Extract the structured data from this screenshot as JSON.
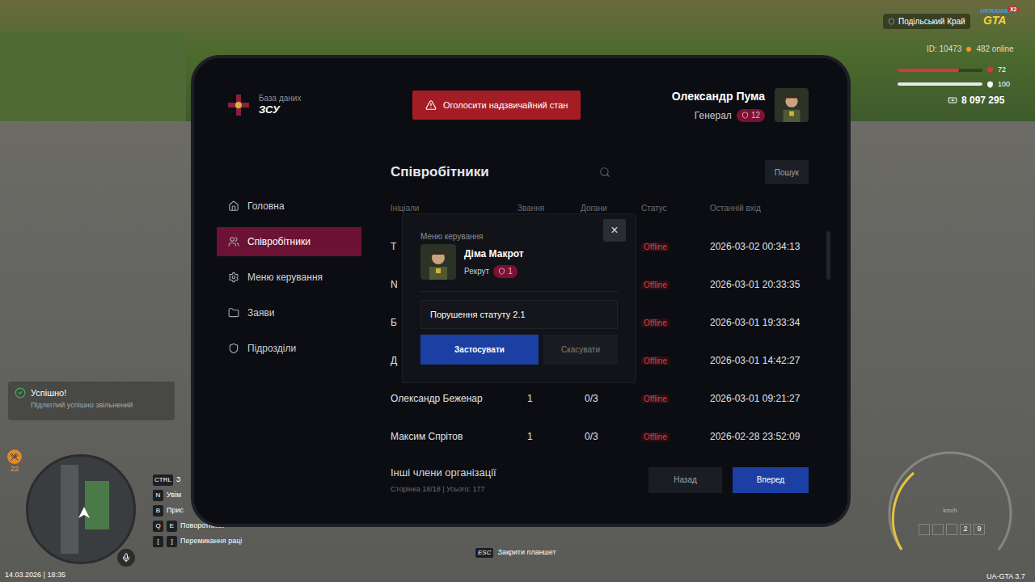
{
  "hud": {
    "region": "Подільський Край",
    "logo": {
      "top": "UKRAINE",
      "bottom": "GTA",
      "badge": "X2"
    },
    "id": "ID: 10473",
    "online": "482 online",
    "health": {
      "reading": "72",
      "level": 0.72
    },
    "armor": {
      "reading": "100",
      "level": 1
    },
    "money": "8 097 295",
    "hunger": "22",
    "datetime": "14.03.2026 | 18:35",
    "close_hint": {
      "key": "ESC",
      "label": "Закрити планшет"
    },
    "speedometer": {
      "unit": "km/h",
      "gears": [
        "2",
        "9"
      ]
    },
    "version": "UA-GTA 3.7"
  },
  "keybinds": [
    {
      "keys": [
        "CTRL"
      ],
      "label": "З"
    },
    {
      "keys": [
        "N"
      ],
      "label": "Увім"
    },
    {
      "keys": [
        "B"
      ],
      "label": "Прис"
    },
    {
      "keys": [
        "Q",
        "E"
      ],
      "label": "Поворотники"
    },
    {
      "keys": [
        "[",
        "]"
      ],
      "label": "Перемикання раці"
    }
  ],
  "toast": {
    "title": "Успішно!",
    "message": "Підлеглий успішно звільнений"
  },
  "tablet": {
    "brand": {
      "subtitle": "База даних",
      "title": "ЗСУ"
    },
    "emergency_button": "Оголосити надзвичайний стан",
    "user": {
      "name": "Олександр Пума",
      "rank": "Генерал",
      "level": "12"
    },
    "sidebar": [
      {
        "label": "Головна",
        "selected": false
      },
      {
        "label": "Співробітники",
        "selected": true
      },
      {
        "label": "Меню керування",
        "selected": false
      },
      {
        "label": "Заяви",
        "selected": false
      },
      {
        "label": "Підрозділи",
        "selected": false
      }
    ],
    "page": {
      "title": "Співробітники",
      "search_button": "Пошук",
      "table": {
        "columns": [
          "Ініціали",
          "Звання",
          "Догани",
          "Статус",
          "Останній вхід"
        ],
        "rows": [
          {
            "name": "Т",
            "status": "Offline",
            "last_login": "2026-03-02 00:34:13"
          },
          {
            "name": "N",
            "status": "Offline",
            "last_login": "2026-03-01 20:33:35"
          },
          {
            "name": "Б",
            "status": "Offline",
            "last_login": "2026-03-01 19:33:34"
          },
          {
            "name": "Д",
            "status": "Offline",
            "last_login": "2026-03-01 14:42:27"
          },
          {
            "name": "Олександр Беженар",
            "rank": "1",
            "warnings": "0/3",
            "status": "Offline",
            "last_login": "2026-03-01 09:21:27"
          },
          {
            "name": "Максим Спрітов",
            "rank": "1",
            "warnings": "0/3",
            "status": "Offline",
            "last_login": "2026-02-28 23:52:09"
          }
        ]
      },
      "footer": {
        "title": "Інші члени організації",
        "info": "Сторінка 18/18 | Усього: 177",
        "prev": "Назад",
        "next": "Вперед"
      }
    },
    "modal": {
      "title": "Меню керування",
      "close": "×",
      "member": {
        "name": "Діма Макрот",
        "rank": "Рекрут",
        "level": "1"
      },
      "reason": "Порушення статуту 2.1",
      "apply": "Застосувати",
      "cancel": "Скасувати"
    }
  }
}
